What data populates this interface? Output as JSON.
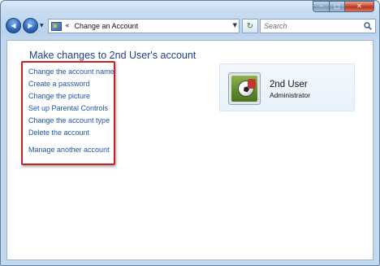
{
  "window": {
    "controls": {
      "minimize_glyph": "–",
      "maximize_glyph": "□",
      "close_glyph": "✕"
    }
  },
  "nav": {
    "back_glyph": "◀",
    "forward_glyph": "▶",
    "history_glyph": "▼"
  },
  "address": {
    "icon": "control-panel-icon",
    "chevron": "«",
    "path": "Change an Account",
    "dropdown_glyph": "▼"
  },
  "refresh": {
    "glyph": "↻"
  },
  "search": {
    "placeholder": "Search",
    "value": ""
  },
  "main": {
    "heading": "Make changes to 2nd User's account",
    "tasks": [
      {
        "label": "Change the account name"
      },
      {
        "label": "Create a password"
      },
      {
        "label": "Change the picture"
      },
      {
        "label": "Set up Parental Controls"
      },
      {
        "label": "Change the account type"
      },
      {
        "label": "Delete the account"
      },
      {
        "label": "Manage another account"
      }
    ],
    "highlight_color": "#c82024",
    "link_color": "#1d55b3"
  },
  "account": {
    "name": "2nd User",
    "type": "Administrator",
    "picture": "soccer-ball-picture"
  }
}
